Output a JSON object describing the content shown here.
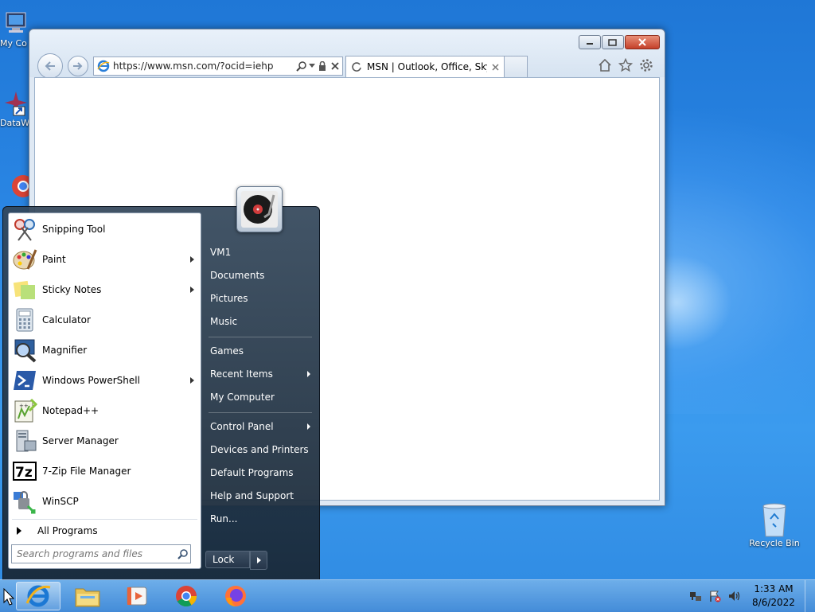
{
  "desktop": {
    "icons": [
      {
        "label": "My Co",
        "name": "my-computer"
      },
      {
        "label": "DataW",
        "name": "dataw"
      },
      {
        "label": "Recycle Bin",
        "name": "recycle-bin"
      }
    ]
  },
  "browser": {
    "address": "https://www.msn.com/?ocid=iehp",
    "tab_title": "MSN | Outlook, Office, Sky..."
  },
  "start_menu": {
    "programs": [
      {
        "label": "Snipping Tool",
        "icon": "scissors-icon",
        "submenu": false
      },
      {
        "label": "Paint",
        "icon": "palette-icon",
        "submenu": true
      },
      {
        "label": "Sticky Notes",
        "icon": "sticky-notes-icon",
        "submenu": true
      },
      {
        "label": "Calculator",
        "icon": "calculator-icon",
        "submenu": false
      },
      {
        "label": "Magnifier",
        "icon": "magnifier-icon",
        "submenu": false
      },
      {
        "label": "Windows PowerShell",
        "icon": "powershell-icon",
        "submenu": true
      },
      {
        "label": "Notepad++",
        "icon": "notepadpp-icon",
        "submenu": false
      },
      {
        "label": "Server Manager",
        "icon": "server-manager-icon",
        "submenu": false
      },
      {
        "label": "7-Zip File Manager",
        "icon": "7zip-icon",
        "submenu": false
      },
      {
        "label": "WinSCP",
        "icon": "winscp-icon",
        "submenu": false
      }
    ],
    "all_programs": "All Programs",
    "search_placeholder": "Search programs and files",
    "right_groups": [
      [
        {
          "label": "VM1"
        },
        {
          "label": "Documents"
        },
        {
          "label": "Pictures"
        },
        {
          "label": "Music"
        }
      ],
      [
        {
          "label": "Games"
        },
        {
          "label": "Recent Items",
          "submenu": true
        },
        {
          "label": "My Computer"
        }
      ],
      [
        {
          "label": "Control Panel",
          "submenu": true
        },
        {
          "label": "Devices and Printers"
        },
        {
          "label": "Default Programs"
        },
        {
          "label": "Help and Support"
        },
        {
          "label": "Run..."
        }
      ]
    ],
    "lock_label": "Lock"
  },
  "taskbar": {
    "pinned": [
      "internet-explorer",
      "file-explorer",
      "media-player",
      "chrome",
      "firefox"
    ],
    "time": "1:33 AM",
    "date": "8/6/2022"
  },
  "colors": {
    "desktop": "#2a86e4",
    "start_menu": "#2a3b4e",
    "close_button": "#c4402a"
  }
}
